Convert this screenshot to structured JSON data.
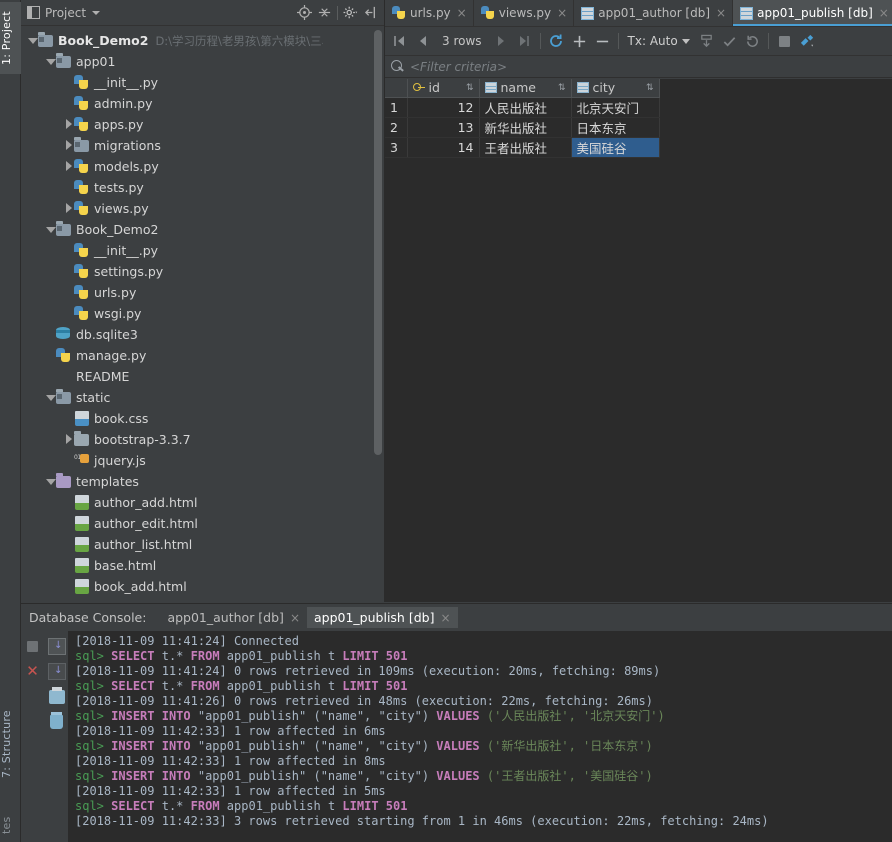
{
  "left_strip": {
    "project_tab": "1: Project",
    "structure_tab": "7: Structure",
    "favorites_tab": "tes"
  },
  "project_panel": {
    "title": "Project",
    "icons": {
      "window_icon": "project-window-icon",
      "locate_icon": "locate-target-icon",
      "collapse_icon": "collapse-all-icon",
      "settings_icon": "gear-icon",
      "hide_icon": "hide-panel-icon"
    },
    "tree": [
      {
        "depth": 0,
        "arrow": "down",
        "icon": "folder-module",
        "label": "Book_Demo2",
        "bold": true,
        "path": "D:\\学习历程\\老男孩\\第六模块\\三、django模"
      },
      {
        "depth": 1,
        "arrow": "down",
        "icon": "folder-module",
        "label": "app01"
      },
      {
        "depth": 2,
        "arrow": "none",
        "icon": "python",
        "label": "__init__.py"
      },
      {
        "depth": 2,
        "arrow": "none",
        "icon": "python",
        "label": "admin.py"
      },
      {
        "depth": 2,
        "arrow": "right",
        "icon": "python",
        "label": "apps.py"
      },
      {
        "depth": 2,
        "arrow": "right",
        "icon": "folder-module",
        "label": "migrations"
      },
      {
        "depth": 2,
        "arrow": "right",
        "icon": "python",
        "label": "models.py"
      },
      {
        "depth": 2,
        "arrow": "none",
        "icon": "python",
        "label": "tests.py"
      },
      {
        "depth": 2,
        "arrow": "right",
        "icon": "python",
        "label": "views.py"
      },
      {
        "depth": 1,
        "arrow": "down",
        "icon": "folder-module",
        "label": "Book_Demo2"
      },
      {
        "depth": 2,
        "arrow": "none",
        "icon": "python",
        "label": "__init__.py"
      },
      {
        "depth": 2,
        "arrow": "none",
        "icon": "python",
        "label": "settings.py"
      },
      {
        "depth": 2,
        "arrow": "none",
        "icon": "python",
        "label": "urls.py"
      },
      {
        "depth": 2,
        "arrow": "none",
        "icon": "python",
        "label": "wsgi.py"
      },
      {
        "depth": 1,
        "arrow": "none",
        "icon": "sqlite",
        "label": "db.sqlite3"
      },
      {
        "depth": 1,
        "arrow": "none",
        "icon": "python",
        "label": "manage.py"
      },
      {
        "depth": 1,
        "arrow": "none",
        "icon": "text",
        "label": "README"
      },
      {
        "depth": 1,
        "arrow": "down",
        "icon": "folder-module",
        "label": "static"
      },
      {
        "depth": 2,
        "arrow": "none",
        "icon": "css",
        "label": "book.css"
      },
      {
        "depth": 2,
        "arrow": "right",
        "icon": "folder-plain",
        "label": "bootstrap-3.3.7"
      },
      {
        "depth": 2,
        "arrow": "none",
        "icon": "js",
        "label": "jquery.js"
      },
      {
        "depth": 1,
        "arrow": "down",
        "icon": "folder-purple",
        "label": "templates"
      },
      {
        "depth": 2,
        "arrow": "none",
        "icon": "html",
        "label": "author_add.html"
      },
      {
        "depth": 2,
        "arrow": "none",
        "icon": "html",
        "label": "author_edit.html"
      },
      {
        "depth": 2,
        "arrow": "none",
        "icon": "html",
        "label": "author_list.html"
      },
      {
        "depth": 2,
        "arrow": "none",
        "icon": "html",
        "label": "base.html"
      },
      {
        "depth": 2,
        "arrow": "none",
        "icon": "html",
        "label": "book_add.html"
      }
    ]
  },
  "editor_tabs": [
    {
      "label": "urls.py",
      "icon": "python-file-icon",
      "active": false,
      "close": "×"
    },
    {
      "label": "views.py",
      "icon": "python-file-icon",
      "active": false,
      "close": "×"
    },
    {
      "label": "app01_author [db]",
      "icon": "db-table-icon",
      "active": false,
      "close": "×"
    },
    {
      "label": "app01_publish [db]",
      "icon": "db-table-icon",
      "active": true,
      "close": "×"
    }
  ],
  "db_toolbar": {
    "first_page": "⏮",
    "prev_page": "◀",
    "rows_label": "3 rows",
    "next_page": "▶",
    "last_page": "⏭",
    "reload_icon": "refresh-icon",
    "add_row": "+",
    "delete_row": "−",
    "tx_label": "Tx: Auto",
    "submit_icon": "submit-icon",
    "commit_icon": "commit-check-icon",
    "rollback_icon": "rollback-icon",
    "stop_icon": "stop-icon",
    "settings_icon": "db-settings-icon"
  },
  "filter": {
    "icon": "search-icon",
    "placeholder": "<Filter criteria>"
  },
  "grid": {
    "columns": [
      {
        "label": "id",
        "icon": "primary-key-icon",
        "sort": "⇅"
      },
      {
        "label": "name",
        "icon": "column-icon",
        "sort": "⇅"
      },
      {
        "label": "city",
        "icon": "column-icon",
        "sort": "⇅"
      }
    ],
    "rows": [
      {
        "n": "1",
        "id": "12",
        "name": "人民出版社",
        "city": "北京天安门",
        "selected": false
      },
      {
        "n": "2",
        "id": "13",
        "name": "新华出版社",
        "city": "日本东京",
        "selected": false
      },
      {
        "n": "3",
        "id": "14",
        "name": "王者出版社",
        "city": "美国硅谷",
        "selected": true
      }
    ],
    "selection_color": "#2f5d8e"
  },
  "console": {
    "label": "Database Console:",
    "tabs": [
      {
        "label": "app01_author [db]",
        "active": false,
        "close": "×"
      },
      {
        "label": "app01_publish [db]",
        "active": true,
        "close": "×"
      }
    ],
    "gutter_icons": [
      "stop-icon",
      "scroll-to-end-icon",
      "cancel-icon",
      "soft-wrap-icon",
      "print-icon",
      "clear-all-icon"
    ],
    "log": [
      {
        "type": "ts",
        "ts": "[2018-11-09 11:41:24]",
        "text": " Connected"
      },
      {
        "type": "sql",
        "prompt": "sql>",
        "sql": "SELECT t.* FROM app01_publish t LIMIT 501"
      },
      {
        "type": "ts",
        "ts": "[2018-11-09 11:41:24]",
        "text": " 0 rows retrieved in 109ms (execution: 20ms, fetching: 89ms)"
      },
      {
        "type": "sql",
        "prompt": "sql>",
        "sql": "SELECT t.* FROM app01_publish t LIMIT 501"
      },
      {
        "type": "ts",
        "ts": "[2018-11-09 11:41:26]",
        "text": " 0 rows retrieved in 48ms (execution: 22ms, fetching: 26ms)"
      },
      {
        "type": "insert",
        "prompt": "sql>",
        "values": "('人民出版社', '北京天安门')"
      },
      {
        "type": "ts",
        "ts": "[2018-11-09 11:42:33]",
        "text": " 1 row affected in 6ms"
      },
      {
        "type": "insert",
        "prompt": "sql>",
        "values": "('新华出版社', '日本东京')"
      },
      {
        "type": "ts",
        "ts": "[2018-11-09 11:42:33]",
        "text": " 1 row affected in 8ms"
      },
      {
        "type": "insert",
        "prompt": "sql>",
        "values": "('王者出版社', '美国硅谷')"
      },
      {
        "type": "ts",
        "ts": "[2018-11-09 11:42:33]",
        "text": " 1 row affected in 5ms"
      },
      {
        "type": "sql",
        "prompt": "sql>",
        "sql": "SELECT t.* FROM app01_publish t LIMIT 501"
      },
      {
        "type": "ts",
        "ts": "[2018-11-09 11:42:33]",
        "text": " 3 rows retrieved starting from 1 in 46ms (execution: 22ms, fetching: 24ms)"
      }
    ],
    "insert_prefix": "INSERT INTO",
    "insert_table": "\"app01_publish\"",
    "insert_cols": "(\"name\", \"city\")",
    "insert_kw": "VALUES"
  }
}
